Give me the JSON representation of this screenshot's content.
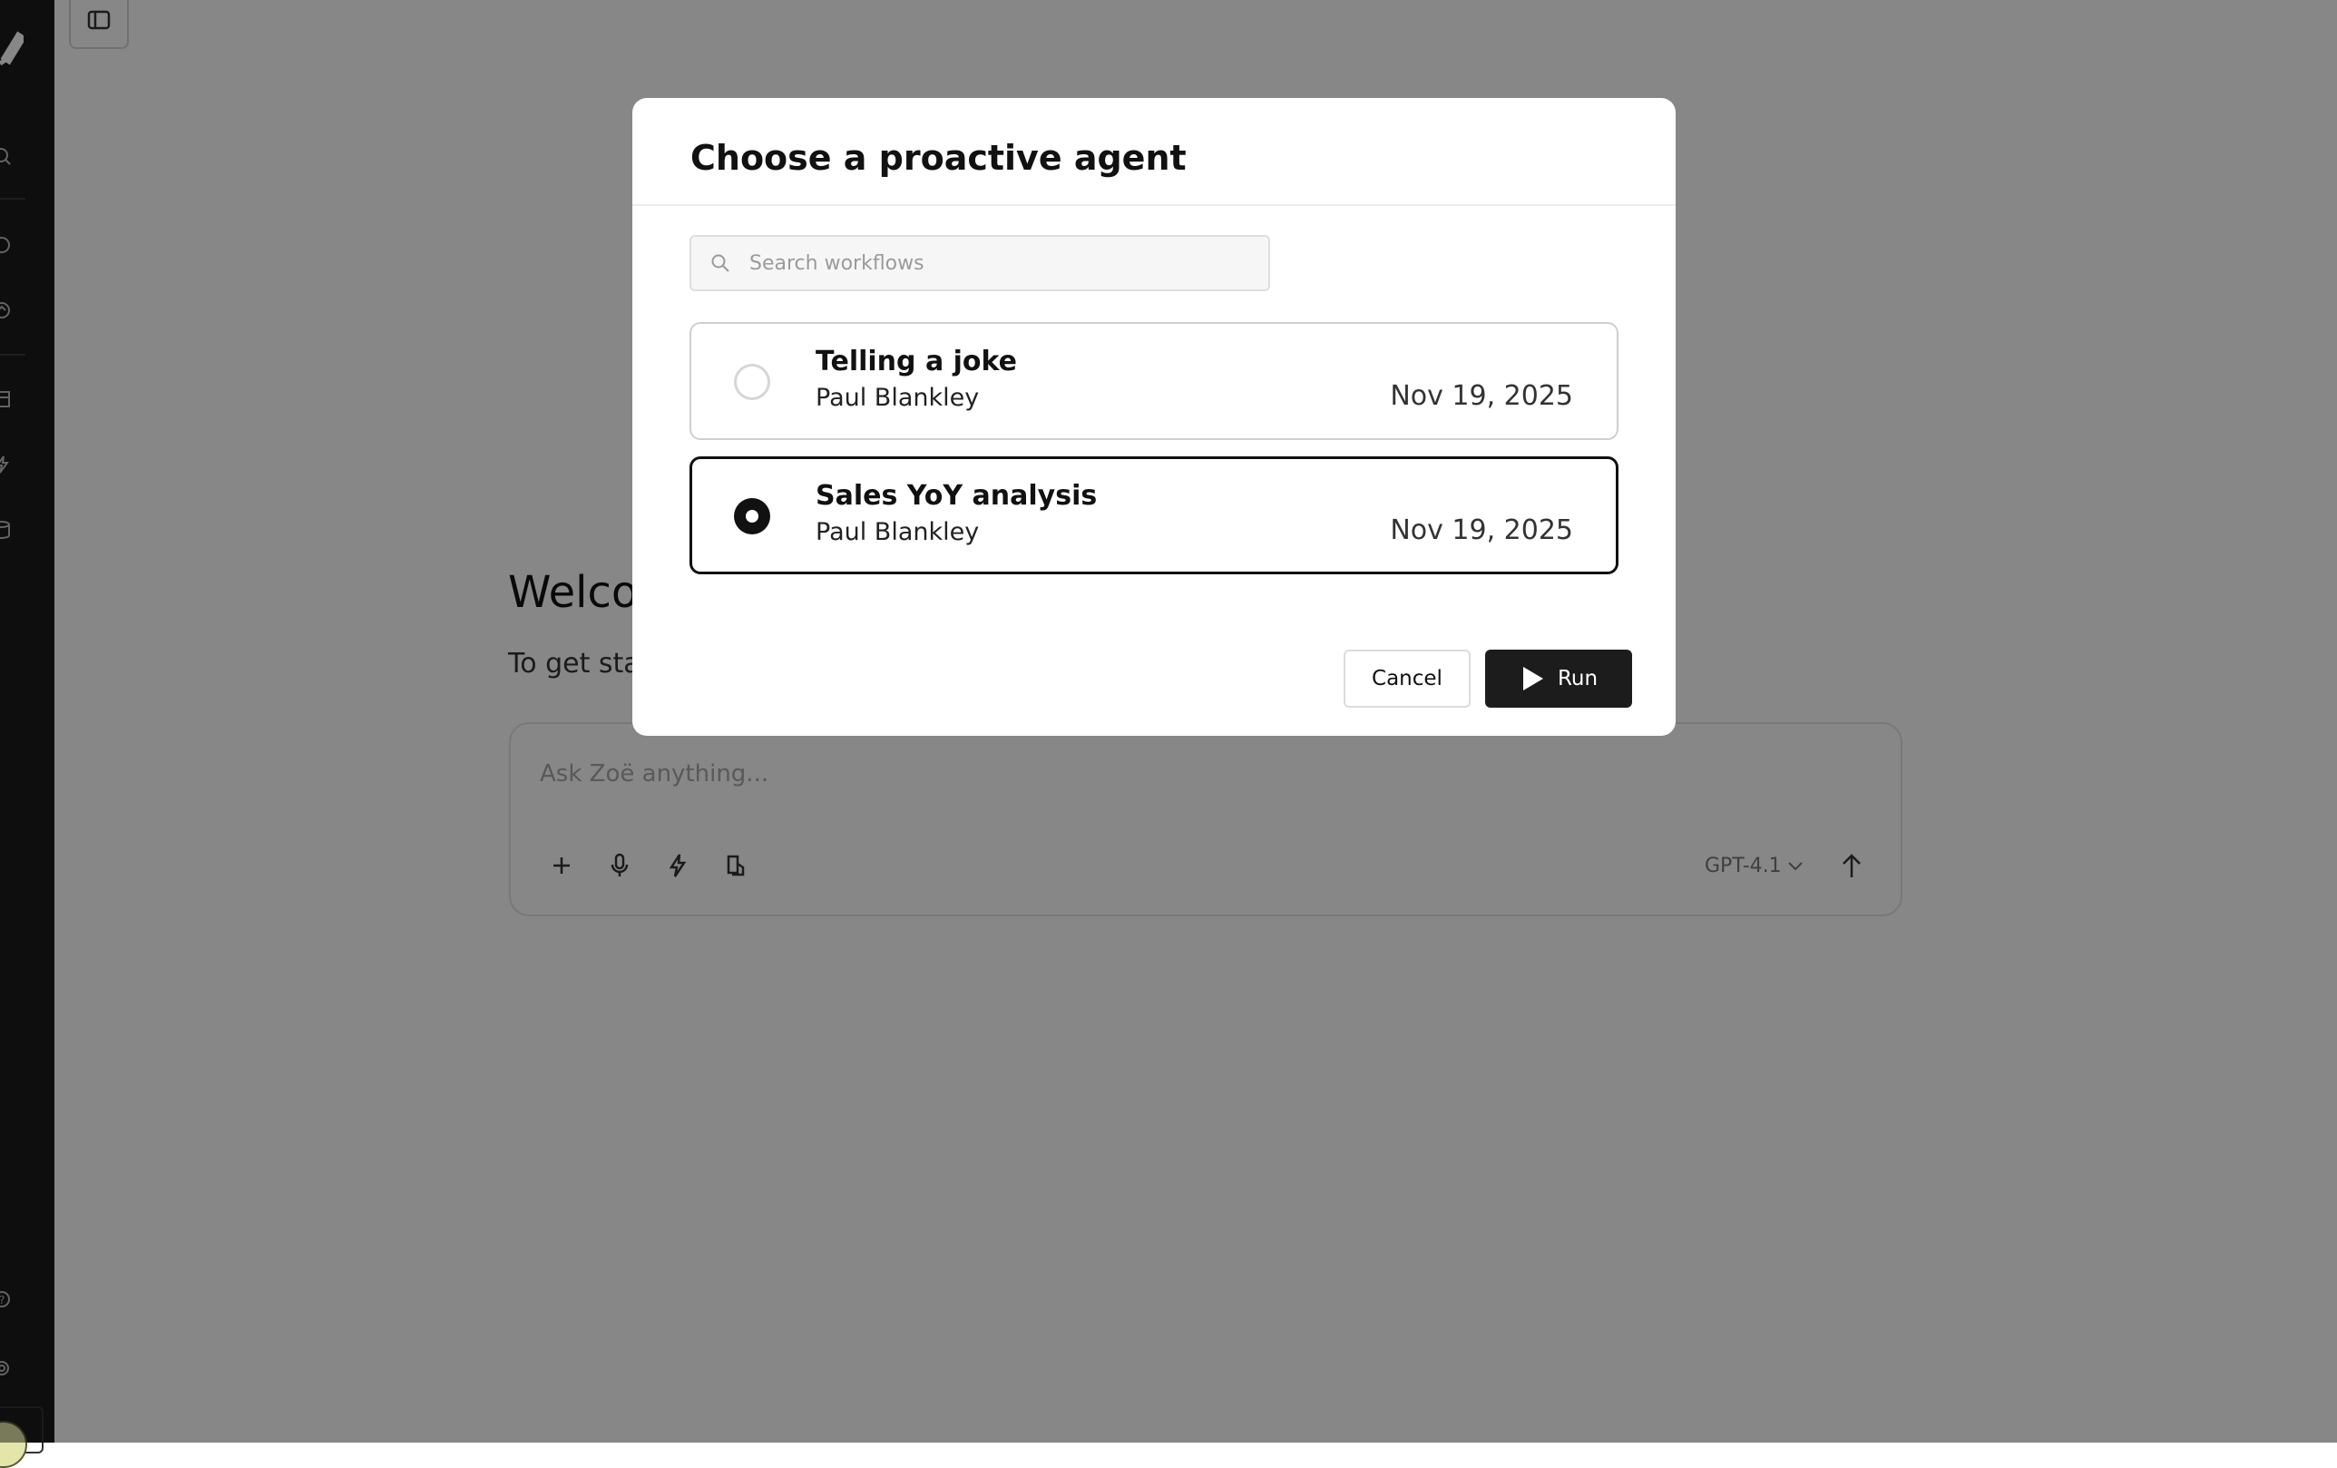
{
  "sidebar": {
    "icons": [
      "logo-icon",
      "search-icon",
      "chat-icon",
      "agents-icon",
      "library-icon",
      "automation-icon",
      "database-icon",
      "help-icon",
      "settings-icon"
    ]
  },
  "main": {
    "welcome_text": "Welco",
    "get_started_text": "To get sta",
    "composer": {
      "placeholder": "Ask Zoë anything...",
      "model": "GPT-4.1"
    }
  },
  "modal": {
    "title": "Choose a proactive agent",
    "search": {
      "placeholder": "Search workflows",
      "value": ""
    },
    "workflows": [
      {
        "name": "Telling a joke",
        "author": "Paul Blankley",
        "date": "Nov 19, 2025",
        "selected": false
      },
      {
        "name": "Sales YoY analysis",
        "author": "Paul Blankley",
        "date": "Nov 19, 2025",
        "selected": true
      }
    ],
    "cancel_label": "Cancel",
    "run_label": "Run"
  }
}
